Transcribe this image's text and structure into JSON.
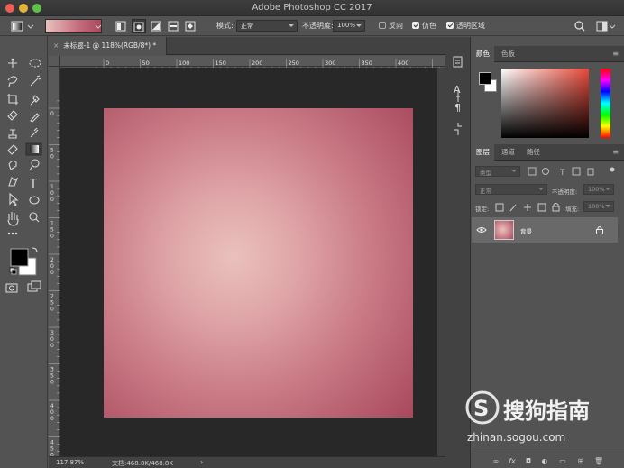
{
  "app": {
    "title": "Adobe Photoshop CC 2017"
  },
  "options_bar": {
    "mode_label": "模式:",
    "mode_value": "正常",
    "opacity_label": "不透明度:",
    "opacity_value": "100%",
    "reverse_label": "反向",
    "reverse_checked": false,
    "dither_label": "仿色",
    "dither_checked": true,
    "transparency_label": "透明区域",
    "transparency_checked": true
  },
  "document": {
    "tab_title": "未标题-1 @ 118%(RGB/8*) *",
    "ruler_h_labels": [
      "0",
      "50",
      "100",
      "150",
      "200",
      "250",
      "300",
      "350",
      "400"
    ],
    "ruler_v_labels": [
      "0",
      "5 0",
      "1 0 0",
      "1 5 0",
      "2 0 0",
      "2 5 0",
      "3 0 0",
      "3 5 0",
      "4 0 0",
      "4 5 0"
    ],
    "zoom": "117.87%",
    "doc_info": "文档:468.8K/468.8K",
    "gradient": {
      "center": "#eac1bc",
      "mid": "#dea3a6",
      "edge": "#a8485d"
    }
  },
  "color_panel": {
    "tab_color": "颜色",
    "tab_swatches": "色板",
    "hue_color": "#e8493a"
  },
  "layers_panel": {
    "tab_layers": "图层",
    "tab_channels": "通道",
    "tab_paths": "路径",
    "filter_kind": "类型",
    "blend_mode": "正常",
    "opacity_label": "不透明度:",
    "opacity_value": "100%",
    "lock_label": "锁定:",
    "fill_label": "填充:",
    "fill_value": "100%",
    "layers": [
      {
        "name": "背景",
        "visible": true,
        "locked": true
      }
    ]
  },
  "watermark": {
    "brand": "搜狗指南",
    "url": "zhinan.sogou.com"
  }
}
